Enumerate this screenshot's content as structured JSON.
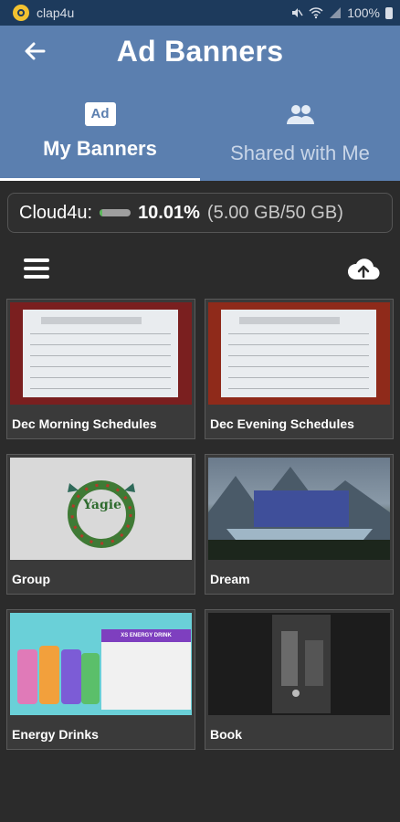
{
  "status_bar": {
    "app_name": "clap4u",
    "battery": "100%"
  },
  "header": {
    "title": "Ad Banners",
    "tabs": [
      {
        "label": "My Banners",
        "icon": "ad-icon",
        "active": true
      },
      {
        "label": "Shared with Me",
        "icon": "people-icon",
        "active": false
      }
    ]
  },
  "storage": {
    "label": "Cloud4u:",
    "percent": "10.01%",
    "detail": "(5.00 GB/50 GB)",
    "used_fraction": 0.1001
  },
  "toolbar": {
    "menu_icon": "menu-icon",
    "upload_icon": "cloud-upload-icon"
  },
  "banners": [
    {
      "title": "Dec Morning Schedules",
      "thumb": "christmas-schedule"
    },
    {
      "title": "Dec Evening Schedules",
      "thumb": "christmas-schedule"
    },
    {
      "title": "Group",
      "thumb": "yagie-wreath"
    },
    {
      "title": "Dream",
      "thumb": "mountain-lake"
    },
    {
      "title": "Energy Drinks",
      "thumb": "energy-drink-promo"
    },
    {
      "title": "Book",
      "thumb": "dark-photo"
    }
  ],
  "thumb_text": {
    "yagie": "Yagie",
    "energy_band": "XS ENERGY DRINK"
  },
  "colors": {
    "header_bg": "#5b7faf",
    "status_bg": "#1d3a5c",
    "body_bg": "#2b2b2b",
    "storage_fill": "#5cb85c"
  }
}
